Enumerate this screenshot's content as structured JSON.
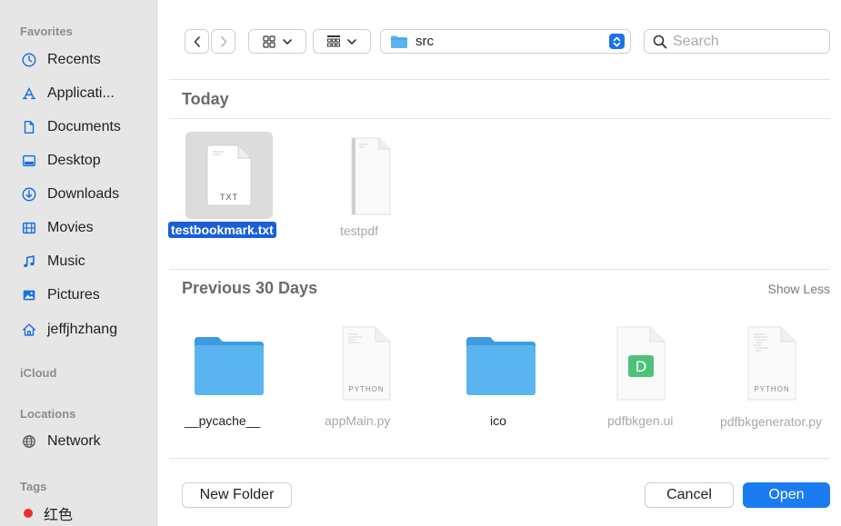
{
  "sidebar": {
    "favorites_title": "Favorites",
    "favorites": [
      {
        "label": "Recents",
        "icon": "clock-icon"
      },
      {
        "label": "Applicati...",
        "icon": "applications-icon"
      },
      {
        "label": "Documents",
        "icon": "document-icon"
      },
      {
        "label": "Desktop",
        "icon": "desktop-icon"
      },
      {
        "label": "Downloads",
        "icon": "download-icon"
      },
      {
        "label": "Movies",
        "icon": "film-icon"
      },
      {
        "label": "Music",
        "icon": "music-note-icon"
      },
      {
        "label": "Pictures",
        "icon": "picture-icon"
      },
      {
        "label": "jeffjhzhang",
        "icon": "home-icon"
      }
    ],
    "icloud_title": "iCloud",
    "locations_title": "Locations",
    "locations": [
      {
        "label": "Network",
        "icon": "globe-icon"
      }
    ],
    "tags_title": "Tags",
    "tags": [
      {
        "label": "红色",
        "color": "#e8302b"
      }
    ]
  },
  "toolbar": {
    "path": "src",
    "search_placeholder": "Search",
    "search_value": ""
  },
  "groups": {
    "today": "Today",
    "previous": "Previous 30 Days",
    "show_less": "Show Less"
  },
  "files_today": [
    {
      "name": "testbookmark.txt",
      "kind": "TXT",
      "selected": true
    },
    {
      "name": "testpdf",
      "kind": "",
      "selected": false
    }
  ],
  "files_previous": [
    {
      "name": "__pycache__",
      "kind": "folder"
    },
    {
      "name": "appMain.py",
      "kind": "PYTHON"
    },
    {
      "name": "ico",
      "kind": "folder"
    },
    {
      "name": "pdfbkgen.ui",
      "kind": "D"
    },
    {
      "name": "pdfbkgenerator.py",
      "kind": "PYTHON"
    }
  ],
  "buttons": {
    "new_folder": "New Folder",
    "cancel": "Cancel",
    "open": "Open"
  },
  "colors": {
    "accent": "#1a7cf0",
    "selection": "#1a5fd8",
    "folder": "#5ab4f0",
    "tag_red": "#e8302b"
  }
}
